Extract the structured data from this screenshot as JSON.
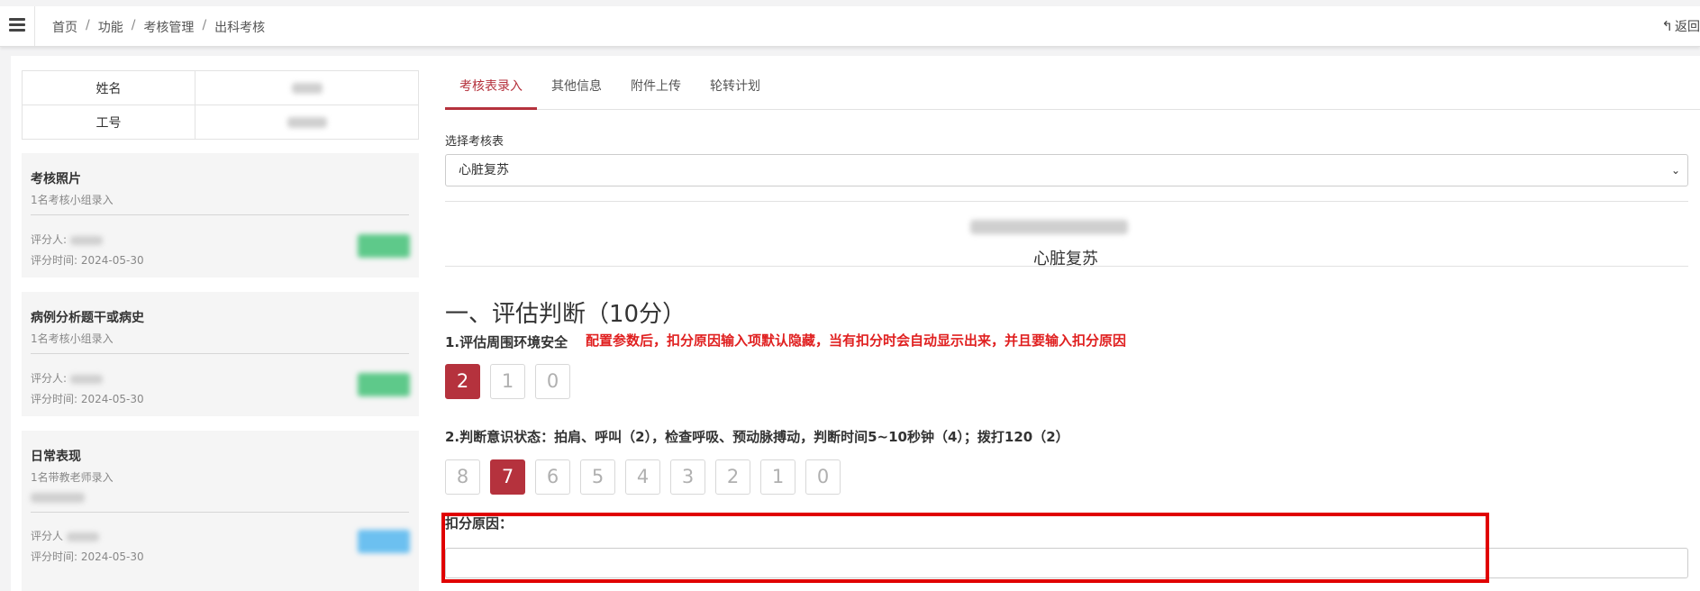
{
  "breadcrumb": [
    "首页",
    "功能",
    "考核管理",
    "出科考核"
  ],
  "back_label": "返回",
  "info": {
    "name_label": "姓名",
    "id_label": "工号"
  },
  "cards": [
    {
      "title": "考核照片",
      "subtitle": "1名考核小组录入",
      "scorer_label": "评分人:",
      "time": "评分时间: 2024-05-30",
      "badge_color": "#5ec98a"
    },
    {
      "title": "病例分析题干或病史",
      "subtitle": "1名考核小组录入",
      "scorer_label": "评分人:",
      "time": "评分时间: 2024-05-30",
      "badge_color": "#5ec98a"
    },
    {
      "title": "日常表现",
      "subtitle": "1名带教老师录入",
      "scorer_label": "评分人",
      "time": "评分时间: 2024-05-30",
      "badge_color": "#6cc0f0"
    }
  ],
  "tabs": [
    "考核表录入",
    "其他信息",
    "附件上传",
    "轮转计划"
  ],
  "active_tab": 0,
  "select": {
    "label": "选择考核表",
    "value": "心脏复苏"
  },
  "form_name": "心脏复苏",
  "section_heading": "一、评估判断（10分）",
  "questions": [
    {
      "text": "1.评估周围环境安全",
      "scores": [
        "2",
        "1",
        "0"
      ],
      "selected": "2"
    },
    {
      "text": "2.判断意识状态：拍肩、呼叫（2），检查呼吸、预动脉搏动，判断时间5~10秒钟（4）；拨打120（2）",
      "scores": [
        "8",
        "7",
        "6",
        "5",
        "4",
        "3",
        "2",
        "1",
        "0"
      ],
      "selected": "7"
    }
  ],
  "annotation_note": "配置参数后，扣分原因输入项默认隐藏，当有扣分时会自动显示出来，并且要输入扣分原因",
  "deduct_label": "扣分原因：",
  "colors": {
    "accent": "#b5323d",
    "annotation": "#e00000"
  }
}
